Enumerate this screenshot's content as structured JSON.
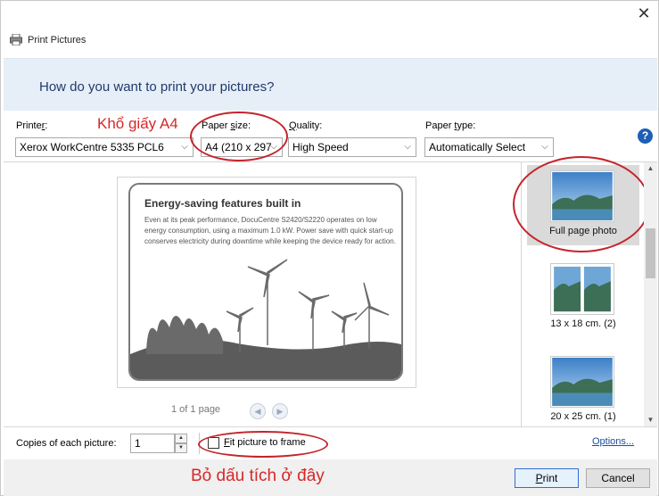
{
  "window": {
    "title": "Print Pictures",
    "close_glyph": "✕",
    "icons": [
      "printer-icon",
      "close-icon",
      "help-icon"
    ]
  },
  "header": {
    "question": "How do you want to print your pictures?"
  },
  "controls": {
    "printer": {
      "label_prefix": "Printe",
      "label_underline": "r",
      "label_suffix": ":",
      "value": "Xerox WorkCentre 5335 PCL6"
    },
    "paper_size": {
      "label_prefix": "Paper ",
      "label_underline": "s",
      "label_suffix": "ize:",
      "value": "A4 (210 x 297"
    },
    "quality": {
      "label_prefix": "",
      "label_underline": "Q",
      "label_suffix": "uality:",
      "value": "High Speed"
    },
    "paper_type": {
      "label_prefix": "Paper ",
      "label_underline": "t",
      "label_suffix": "ype:",
      "value": "Automatically Select"
    },
    "help_glyph": "?"
  },
  "annotations": {
    "paper_size_note": "Khổ giấy A4",
    "checkbox_note": "Bỏ dấu tích ở đây",
    "color": "#d62828"
  },
  "preview": {
    "card_title": "Energy-saving features built in",
    "card_body": "Even at its peak performance, DocuCentre S2420/S2220 operates on low energy consumption, using a maximum 1.0 kW. Power save with quick start-up conserves electricity during downtime while keeping the device ready for action.",
    "page_counter": "1 of 1 page",
    "prev_glyph": "◀",
    "next_glyph": "▶"
  },
  "layouts": [
    {
      "label": "Full page photo",
      "selected": true
    },
    {
      "label": "13 x 18 cm. (2)",
      "selected": false
    },
    {
      "label": "20 x 25 cm. (1)",
      "selected": false
    }
  ],
  "footer": {
    "copies_label": "Copies of each picture:",
    "copies_value": "1",
    "fit_prefix": "",
    "fit_underline": "F",
    "fit_suffix": "it picture to frame",
    "fit_checked": false,
    "options_label": "Options..."
  },
  "buttons": {
    "print_underline": "P",
    "print_suffix": "rint",
    "cancel": "Cancel"
  }
}
